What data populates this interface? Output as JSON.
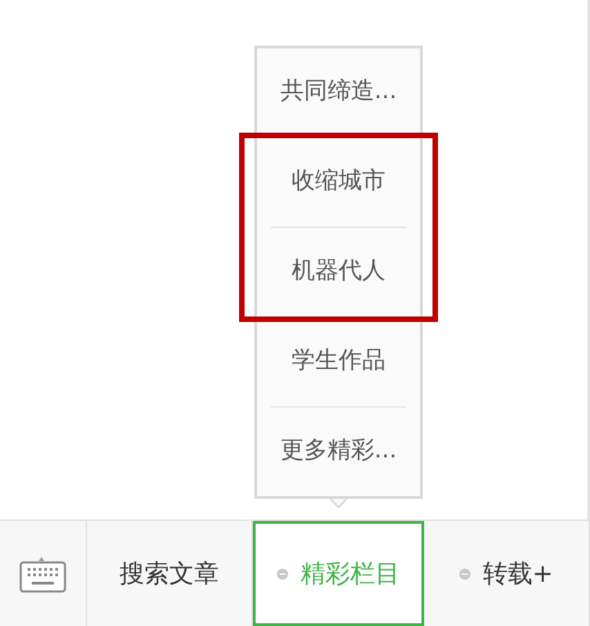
{
  "menu_bar": {
    "items": [
      {
        "label": "搜索文章",
        "has_submenu": false,
        "selected": false
      },
      {
        "label": "精彩栏目",
        "has_submenu": true,
        "selected": true,
        "submenu": [
          {
            "label": "共同缔造...",
            "highlighted": false
          },
          {
            "label": "收缩城市",
            "highlighted": true
          },
          {
            "label": "机器代人",
            "highlighted": true
          },
          {
            "label": "学生作品",
            "highlighted": false
          },
          {
            "label": "更多精彩...",
            "highlighted": false
          }
        ]
      },
      {
        "label": "转载+",
        "has_submenu": true,
        "selected": false
      }
    ]
  }
}
